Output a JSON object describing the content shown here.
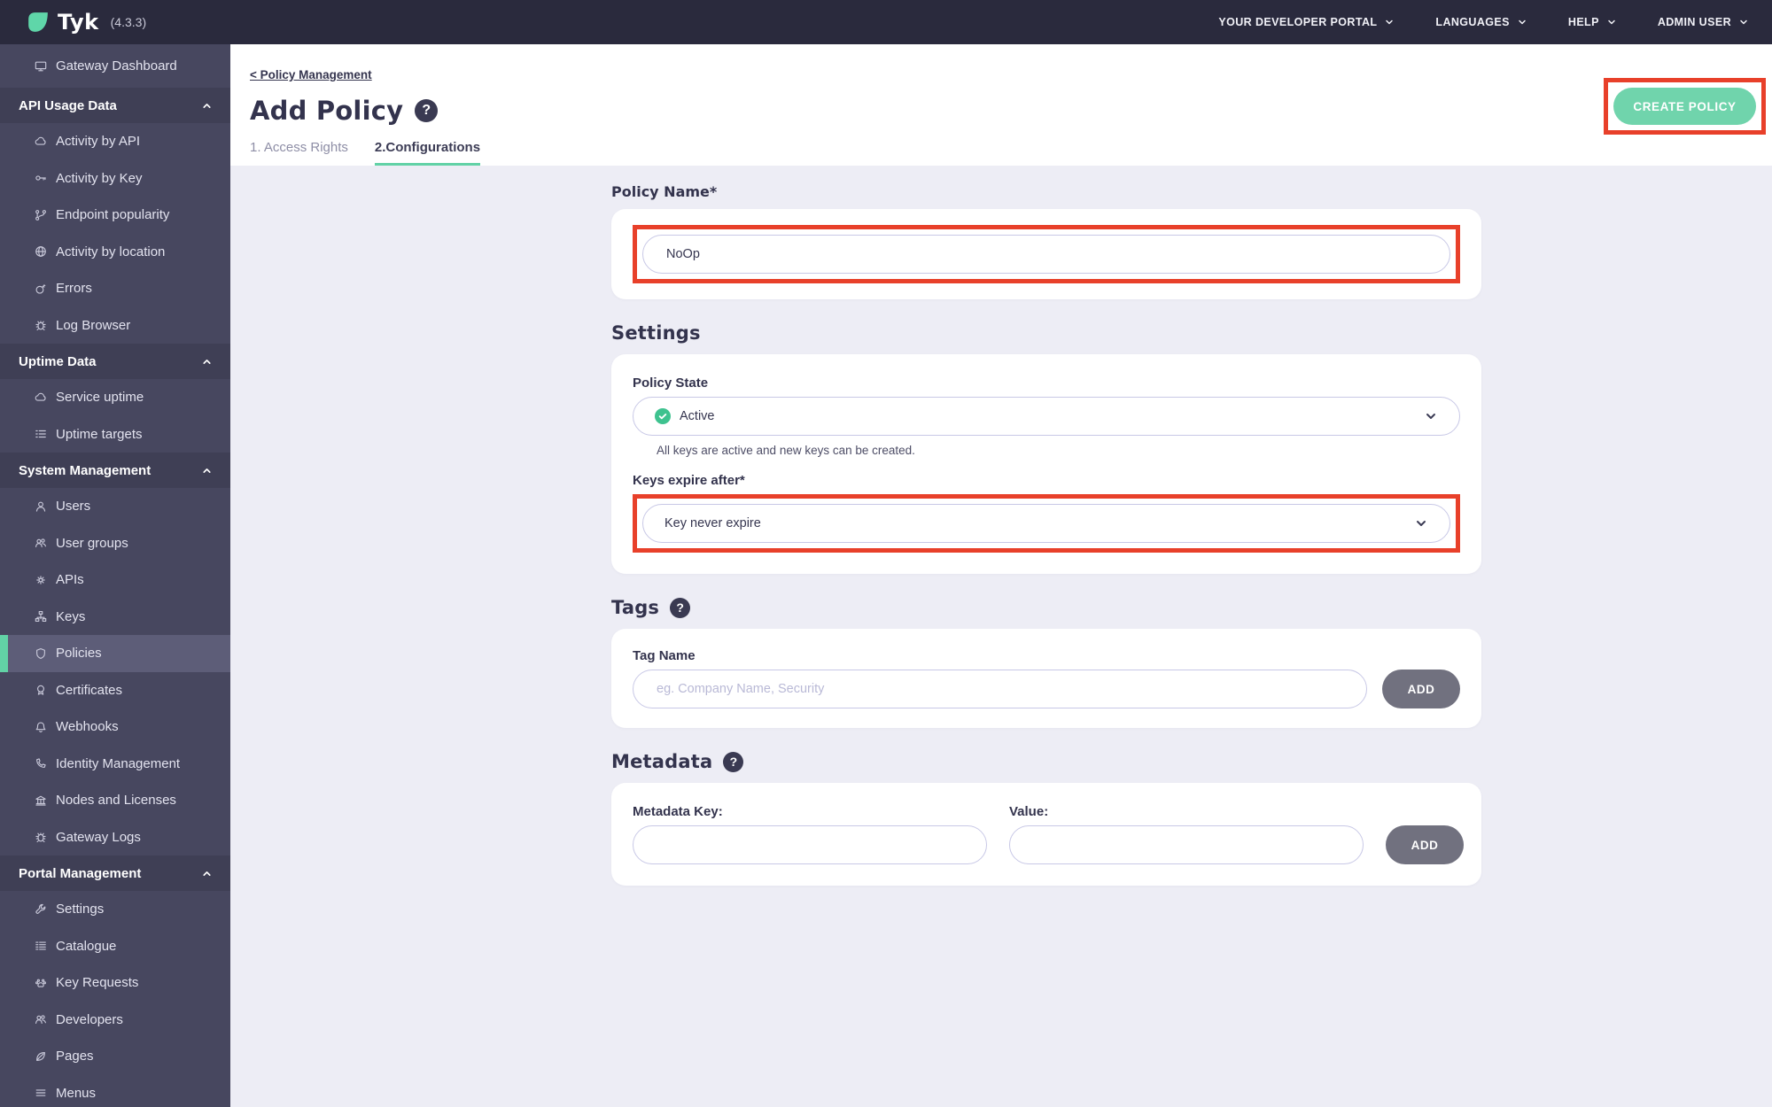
{
  "topbar": {
    "brand": "Tyk",
    "version": "(4.3.3)",
    "menus": [
      {
        "label": "YOUR DEVELOPER PORTAL"
      },
      {
        "label": "LANGUAGES"
      },
      {
        "label": "HELP"
      },
      {
        "label": "ADMIN USER"
      }
    ]
  },
  "sidebar": {
    "dashboard": {
      "label": "Gateway Dashboard",
      "icon": "monitor"
    },
    "sections": [
      {
        "label": "API Usage Data",
        "items": [
          {
            "label": "Activity by API",
            "icon": "cloud"
          },
          {
            "label": "Activity by Key",
            "icon": "key"
          },
          {
            "label": "Endpoint popularity",
            "icon": "branch"
          },
          {
            "label": "Activity by location",
            "icon": "globe"
          },
          {
            "label": "Errors",
            "icon": "bomb"
          },
          {
            "label": "Log Browser",
            "icon": "bug"
          }
        ]
      },
      {
        "label": "Uptime Data",
        "items": [
          {
            "label": "Service uptime",
            "icon": "cloud"
          },
          {
            "label": "Uptime targets",
            "icon": "list"
          }
        ]
      },
      {
        "label": "System Management",
        "items": [
          {
            "label": "Users",
            "icon": "user"
          },
          {
            "label": "User groups",
            "icon": "users"
          },
          {
            "label": "APIs",
            "icon": "cogs"
          },
          {
            "label": "Keys",
            "icon": "sitemap"
          },
          {
            "label": "Policies",
            "icon": "shield",
            "active": true
          },
          {
            "label": "Certificates",
            "icon": "certificate"
          },
          {
            "label": "Webhooks",
            "icon": "bell"
          },
          {
            "label": "Identity Management",
            "icon": "phone"
          },
          {
            "label": "Nodes and Licenses",
            "icon": "bank"
          },
          {
            "label": "Gateway Logs",
            "icon": "bug"
          }
        ]
      },
      {
        "label": "Portal Management",
        "items": [
          {
            "label": "Settings",
            "icon": "wrench"
          },
          {
            "label": "Catalogue",
            "icon": "catalogue"
          },
          {
            "label": "Key Requests",
            "icon": "paw"
          },
          {
            "label": "Developers",
            "icon": "users"
          },
          {
            "label": "Pages",
            "icon": "leaf"
          },
          {
            "label": "Menus",
            "icon": "menu"
          }
        ]
      }
    ]
  },
  "header": {
    "breadcrumb": "< Policy Management",
    "title": "Add Policy",
    "tabs": [
      {
        "label": "1. Access Rights",
        "active": false
      },
      {
        "label": "2.Configurations",
        "active": true
      }
    ],
    "create_button": "CREATE POLICY"
  },
  "form": {
    "policy_name": {
      "label": "Policy Name*",
      "value": "NoOp"
    },
    "settings": {
      "heading": "Settings",
      "policy_state": {
        "label": "Policy State",
        "value": "Active",
        "helper": "All keys are active and new keys can be created."
      },
      "keys_expire": {
        "label": "Keys expire after*",
        "value": "Key never expire"
      }
    },
    "tags": {
      "heading": "Tags",
      "field_label": "Tag Name",
      "placeholder": "eg. Company Name, Security",
      "add_button": "ADD"
    },
    "metadata": {
      "heading": "Metadata",
      "key_label": "Metadata Key:",
      "value_label": "Value:",
      "add_button": "ADD"
    }
  },
  "annotations": {
    "color": "#e8402a",
    "highlighted": [
      "create-policy-button",
      "policy-name-input",
      "keys-expire-after-select"
    ]
  },
  "colors": {
    "topbar_bg": "#2a2a3d",
    "sidebar_bg": "#47475f",
    "sidebar_section_bg": "#3f3f55",
    "sidebar_active_bg": "#5d5d78",
    "accent_mint": "#62d2a6",
    "create_button_bg": "#70d4ac",
    "content_bg": "#ededf5",
    "add_button_bg": "#71717f",
    "active_check_green": "#3ec28f",
    "annotation_red": "#e8402a"
  }
}
